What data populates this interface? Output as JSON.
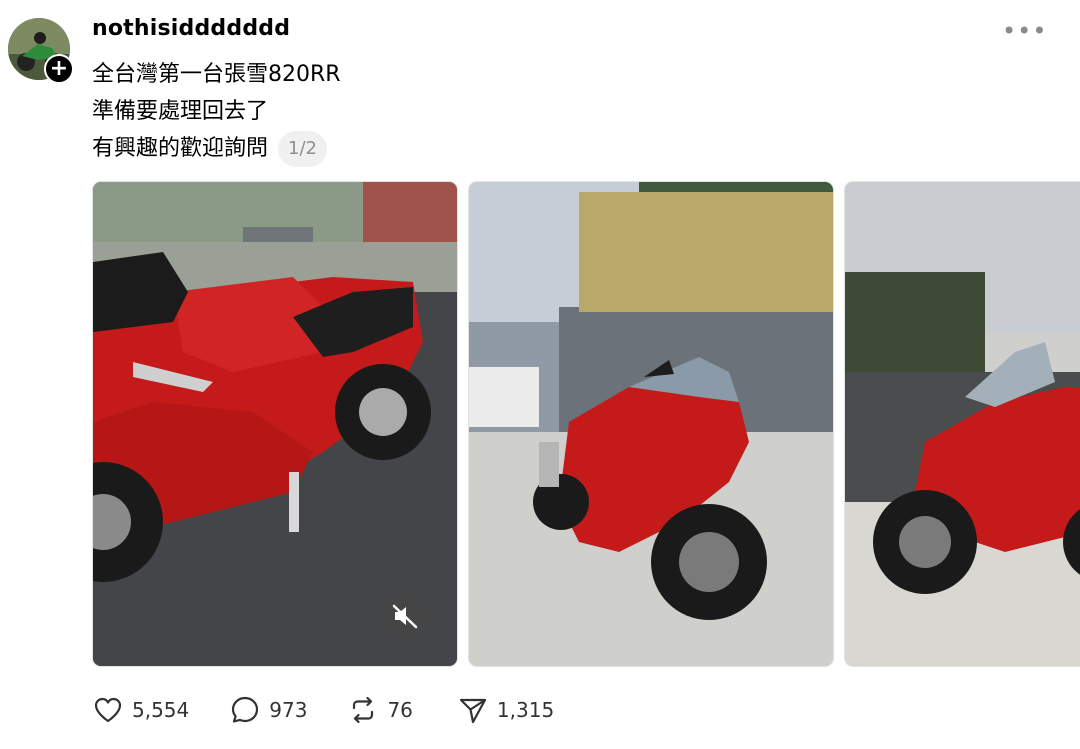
{
  "post": {
    "username": "nothisiddddddd",
    "caption_lines": [
      "全台灣第一台張雪820RR",
      "準備要處理回去了",
      "有興趣的歡迎詢問"
    ],
    "page_indicator": "1/2",
    "more_icon": "more-horizontal-icon",
    "follow_icon": "plus-icon"
  },
  "media": [
    {
      "kind": "video",
      "subject": "red motorcycle side close-up",
      "muted_icon": "speaker-muted-icon"
    },
    {
      "kind": "image",
      "subject": "red motorcycle front three-quarter view"
    },
    {
      "kind": "image",
      "subject": "red motorcycle front view"
    }
  ],
  "actions": {
    "like": {
      "icon": "heart-icon",
      "count": "5,554"
    },
    "reply": {
      "icon": "comment-icon",
      "count": "973"
    },
    "repost": {
      "icon": "repost-icon",
      "count": "76"
    },
    "share": {
      "icon": "send-icon",
      "count": "1,315"
    }
  },
  "colors": {
    "accent_bike": "#c41a1a",
    "muted_text": "#8e8e8e",
    "badge_bg": "#000000"
  }
}
